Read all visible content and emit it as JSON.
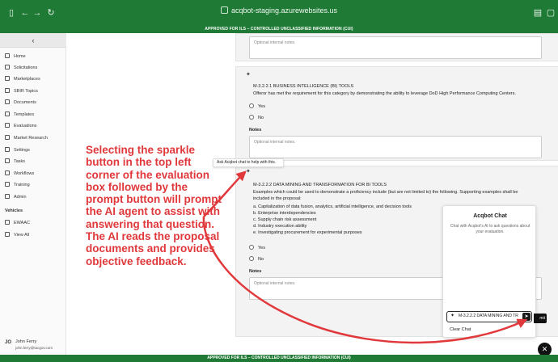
{
  "browser": {
    "url": "acqbot-staging.azurewebsites.us"
  },
  "banner": {
    "top": "APPROVED FOR ILS – CONTROLLED UNCLASSIFIED INFORMATION (CUI)",
    "bottom": "APPROVED FOR ILS – CONTROLLED UNCLASSIFIED INFORMATION (CUI)"
  },
  "sidebar": {
    "collapse_icon": "‹",
    "items": [
      {
        "label": "Home",
        "icon": "home-icon"
      },
      {
        "label": "Solicitations",
        "icon": "solicitations-icon"
      },
      {
        "label": "Marketplaces",
        "icon": "marketplaces-icon"
      },
      {
        "label": "SBIR Topics",
        "icon": "sbir-icon"
      },
      {
        "label": "Documents",
        "icon": "documents-icon"
      },
      {
        "label": "Templates",
        "icon": "templates-icon"
      },
      {
        "label": "Evaluations",
        "icon": "evaluations-icon"
      },
      {
        "label": "Market Research",
        "icon": "research-icon"
      },
      {
        "label": "Settings",
        "icon": "gear-icon"
      },
      {
        "label": "Tasks",
        "icon": "tasks-icon"
      },
      {
        "label": "Workflows",
        "icon": "workflows-icon"
      },
      {
        "label": "Training",
        "icon": "training-icon"
      },
      {
        "label": "Admin",
        "icon": "admin-icon"
      }
    ],
    "vehicles_header": "Vehicles",
    "vehicles": [
      {
        "label": "EWAAC"
      },
      {
        "label": "View All"
      }
    ],
    "user": {
      "initials": "JO",
      "name": "John Ferry",
      "email": "john.ferry@tacgov.com"
    }
  },
  "main": {
    "notes_placeholder": "Optional internal notes.",
    "q1": {
      "title": "M-3.2.2.1 BUSINESS INTELLIGENCE (BI) TOOLS",
      "desc": "Offeror has met the requirement for this category by demonstrating the ability to leverage DoD High Performance Computing Centers.",
      "yes": "Yes",
      "no": "No",
      "notes_label": "Notes"
    },
    "tooltip": "Ask Acqbot chat to help with this.",
    "q2": {
      "title": "M-3.2.2.2 DATA MINING AND TRANSFORMATION FOR BI TOOLS",
      "desc_lead": "Examples which could be used to demonstrate a proficiency include (but are not limited to) the following.  Supporting examples shall be included in the proposal:",
      "bullets": [
        "a. Capitalization of data fusion, analytics, artificial intelligence, and decision tools",
        "b. Enterprise interdependencies",
        "c. Supply chain risk assessment",
        "d. Industry execution ability",
        "e. Investigating procurement for experimental purposes"
      ],
      "yes": "Yes",
      "no": "No",
      "notes_label": "Notes"
    }
  },
  "chat": {
    "title": "Acqbot Chat",
    "subtitle": "Chat with Acqbot's AI to ask questions about your evaluation.",
    "input_value": "M-3.2.2.2 DATA MINING AND TR",
    "clear_label": "Clear Chat",
    "submit_label": "mit"
  },
  "annotation": {
    "text": "Selecting the sparkle button in the top left corner of the evaluation box followed by the prompt button will prompt the AI agent to assist with answering that question. The AI reads the proposal documents and provides objective feedback.",
    "color": "#e0383b"
  }
}
